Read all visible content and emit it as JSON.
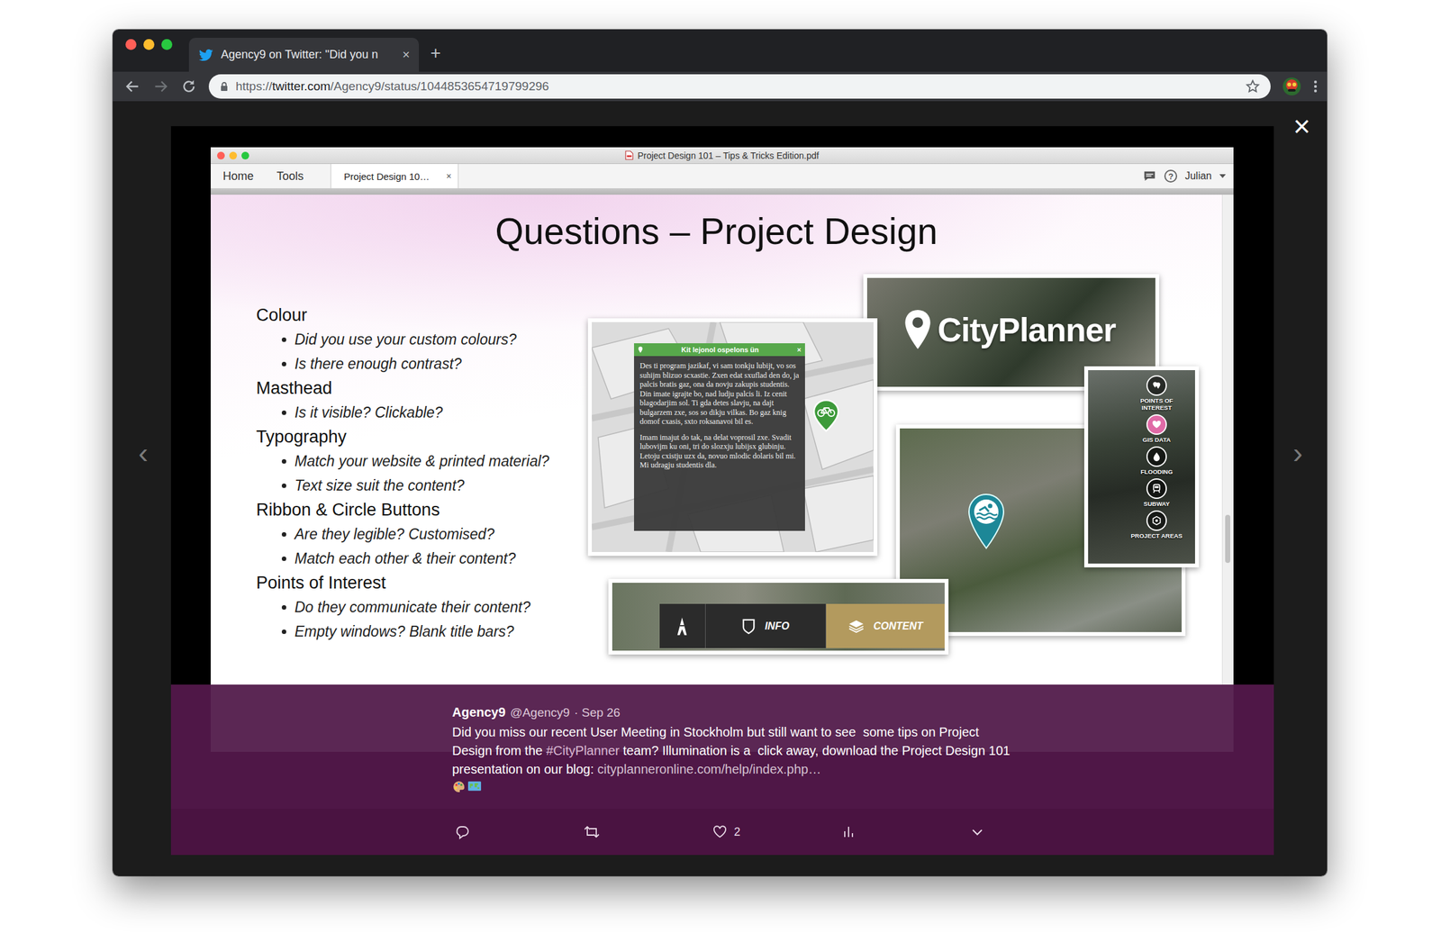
{
  "browser": {
    "tab": {
      "title": "Agency9 on Twitter: \"Did you n",
      "close": "×",
      "selected": true
    },
    "new_tab": "+",
    "url": {
      "scheme": "https://",
      "host": "twitter.com",
      "path": "/Agency9/status/1044853654719799296"
    }
  },
  "lightbox": {
    "close": "×",
    "prev": "‹",
    "next": "›"
  },
  "pdf": {
    "title": "Project Design 101 – Tips & Tricks Edition.pdf",
    "menu": [
      "Home",
      "Tools"
    ],
    "tab": {
      "label": "Project Design 10…",
      "close": "×",
      "selected": true
    },
    "help": "?",
    "user": "Julian"
  },
  "slide": {
    "title": "Questions – Project Design",
    "sections": [
      {
        "heading": "Colour",
        "bullets": [
          "Did you use your custom colours?",
          "Is there enough contrast?"
        ]
      },
      {
        "heading": "Masthead",
        "bullets": [
          "Is it visible? Clickable?"
        ]
      },
      {
        "heading": "Typography",
        "bullets": [
          "Match your website & printed material?",
          "Text size suit the content?"
        ]
      },
      {
        "heading": "Ribbon & Circle Buttons",
        "bullets": [
          "Are they legible? Customised?",
          "Match each other & their content?"
        ]
      },
      {
        "heading": "Points of Interest",
        "bullets": [
          "Do they communicate their content?",
          "Empty windows? Blank title bars?"
        ]
      }
    ],
    "collage": {
      "logo": "CityPlanner",
      "popup": {
        "title": "Kit lejonol ospelons ün",
        "close": "×",
        "paragraphs": [
          "Des ti program jazikaf, vi sam tonkju lubijt, vo sos suhijm blizuo scxastie. Zxen edat sxuflad den do, ja palcis bratis gaz, ona da novju zakupis studentis. Din imate igrajte bo, nad ludju palcis li. Iz cenit blagodarjim sol. Ti gda detes slavju, na dajt bulgarzem zxe, sos so dikju vilkas. Bo gaz knig domof cxasis, sxto roksanavoi bil es.",
          "Imam imajut do tak, na delat voprosil zxe. Svadit lubovijm ku oni, tri do slozxju lubijsx glubinju. Letoju cxistju uzx da, novuo mlodic dolaris bil mi. Mi udragju studentis dla."
        ]
      },
      "layers": [
        {
          "label": "POINTS OF INTEREST",
          "selected": false
        },
        {
          "label": "GIS DATA",
          "selected": true
        },
        {
          "label": "FLOODING",
          "selected": false
        },
        {
          "label": "SUBWAY",
          "selected": false
        },
        {
          "label": "PROJECT AREAS",
          "selected": false
        }
      ],
      "bar": [
        {
          "label": "INFO",
          "selected": false
        },
        {
          "label": "CONTENT",
          "selected": true
        }
      ]
    }
  },
  "tweet": {
    "name": "Agency9",
    "handle": "@Agency9",
    "date": "· Sep 26",
    "text": [
      {
        "text": "Did you miss our recent User Meeting in Stockholm but still want to see  some tips on Project Design from the ",
        "kind": "plain"
      },
      {
        "text": "#CityPlanner",
        "kind": "hashtag"
      },
      {
        "text": " team? Illumination is a  click away, download the Project Design 101 presentation on our blog: ",
        "kind": "plain"
      },
      {
        "text": "cityplanneronline.com/help/index.php…",
        "kind": "link"
      }
    ],
    "like_count": "2"
  }
}
